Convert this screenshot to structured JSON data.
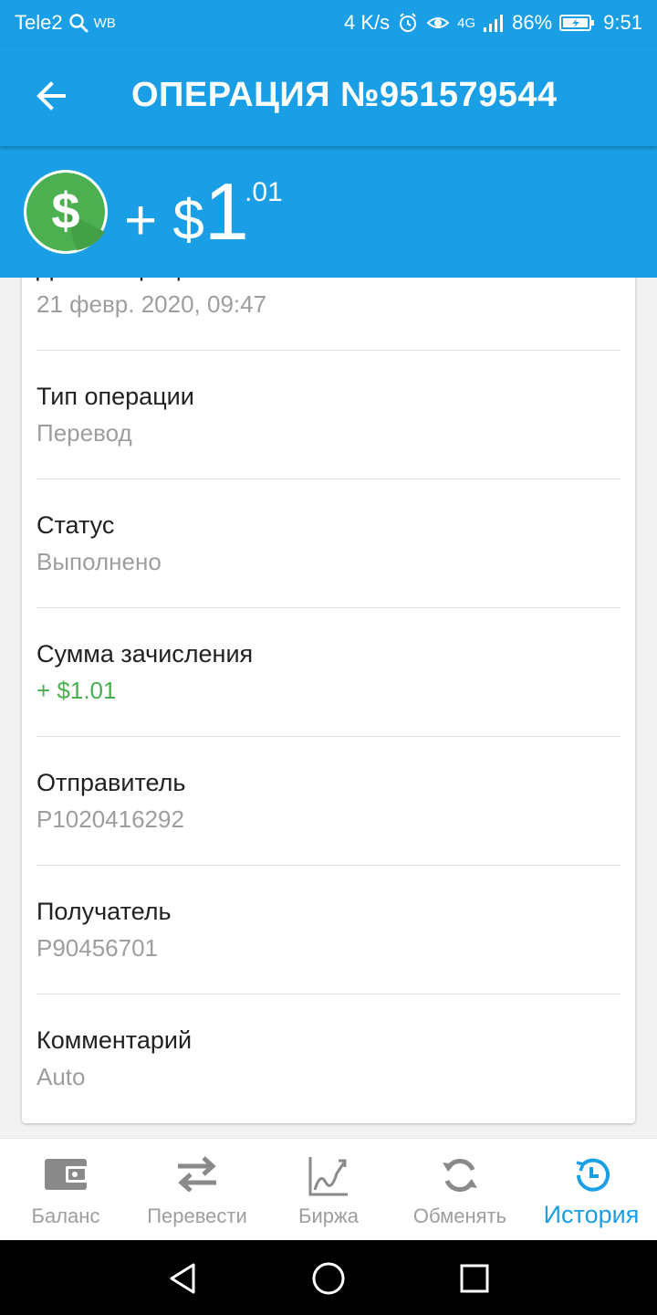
{
  "status_bar": {
    "carrier": "Tele2",
    "carrier_extra": "WB",
    "speed": "4 K/s",
    "network": "4G",
    "battery": "86%",
    "time": "9:51"
  },
  "header": {
    "title": "ОПЕРАЦИЯ №951579544",
    "back_icon": "arrow-left-icon"
  },
  "amount": {
    "sign_currency": "+ $",
    "whole": "1",
    "cents": ".01",
    "icon": "dollar-coin-icon",
    "icon_color": "#4caf50"
  },
  "details": [
    {
      "label": "Дата операции",
      "value": "21 февр. 2020, 09:47"
    },
    {
      "label": "Тип операции",
      "value": "Перевод"
    },
    {
      "label": "Статус",
      "value": "Выполнено"
    },
    {
      "label": "Сумма зачисления",
      "value": "+ $1.01",
      "value_color": "#4caf50"
    },
    {
      "label": "Отправитель",
      "value": "P1020416292"
    },
    {
      "label": "Получатель",
      "value": "P90456701"
    },
    {
      "label": "Комментарий",
      "value": "Auto"
    }
  ],
  "bottom_nav": [
    {
      "label": "Баланс",
      "icon": "wallet-icon"
    },
    {
      "label": "Перевести",
      "icon": "transfer-arrows-icon"
    },
    {
      "label": "Биржа",
      "icon": "chart-icon"
    },
    {
      "label": "Обменять",
      "icon": "refresh-icon"
    },
    {
      "label": "История",
      "icon": "history-icon",
      "active": true
    }
  ],
  "colors": {
    "primary": "#1a9ee5",
    "green": "#4caf50",
    "inactive": "#9e9e9e"
  }
}
